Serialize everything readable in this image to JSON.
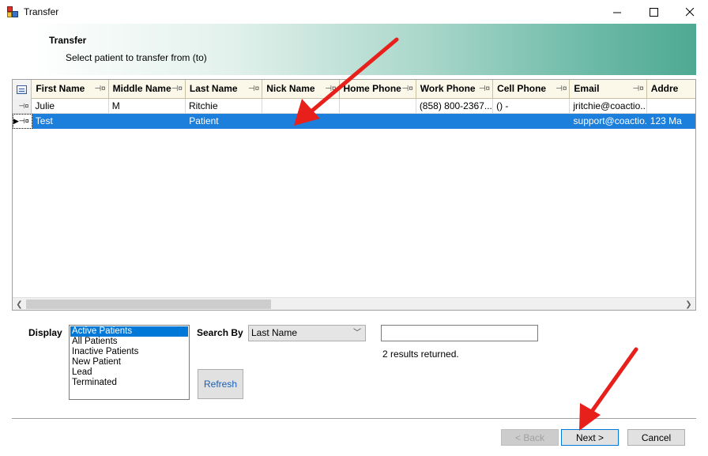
{
  "window": {
    "title": "Transfer"
  },
  "header": {
    "title": "Transfer",
    "subtitle": "Select patient to transfer from (to)"
  },
  "grid": {
    "columns": [
      "First Name",
      "Middle Name",
      "Last Name",
      "Nick Name",
      "Home Phone",
      "Work Phone",
      "Cell Phone",
      "Email",
      "Addre"
    ],
    "rows": [
      {
        "cells": [
          "Julie",
          "M",
          "Ritchie",
          "",
          "",
          "(858)  800-2367...",
          "() -",
          "jritchie@coactio...",
          ""
        ]
      },
      {
        "cells": [
          "Test",
          "",
          "Patient",
          "",
          "",
          "",
          "",
          "support@coactio...",
          "123 Ma"
        ]
      }
    ],
    "selected_row": 1
  },
  "display": {
    "label": "Display",
    "options": [
      "Active Patients",
      "All Patients",
      "Inactive Patients",
      "New Patient",
      "Lead",
      "Terminated"
    ],
    "selected": "Active Patients"
  },
  "search": {
    "label": "Search By",
    "by_value": "Last Name",
    "query": "",
    "results_text": "2 results returned."
  },
  "buttons": {
    "refresh": "Refresh",
    "back": "< Back",
    "next": "Next >",
    "cancel": "Cancel"
  },
  "colors": {
    "selection": "#1c7fdc",
    "annotation_arrow": "#e8201c"
  }
}
